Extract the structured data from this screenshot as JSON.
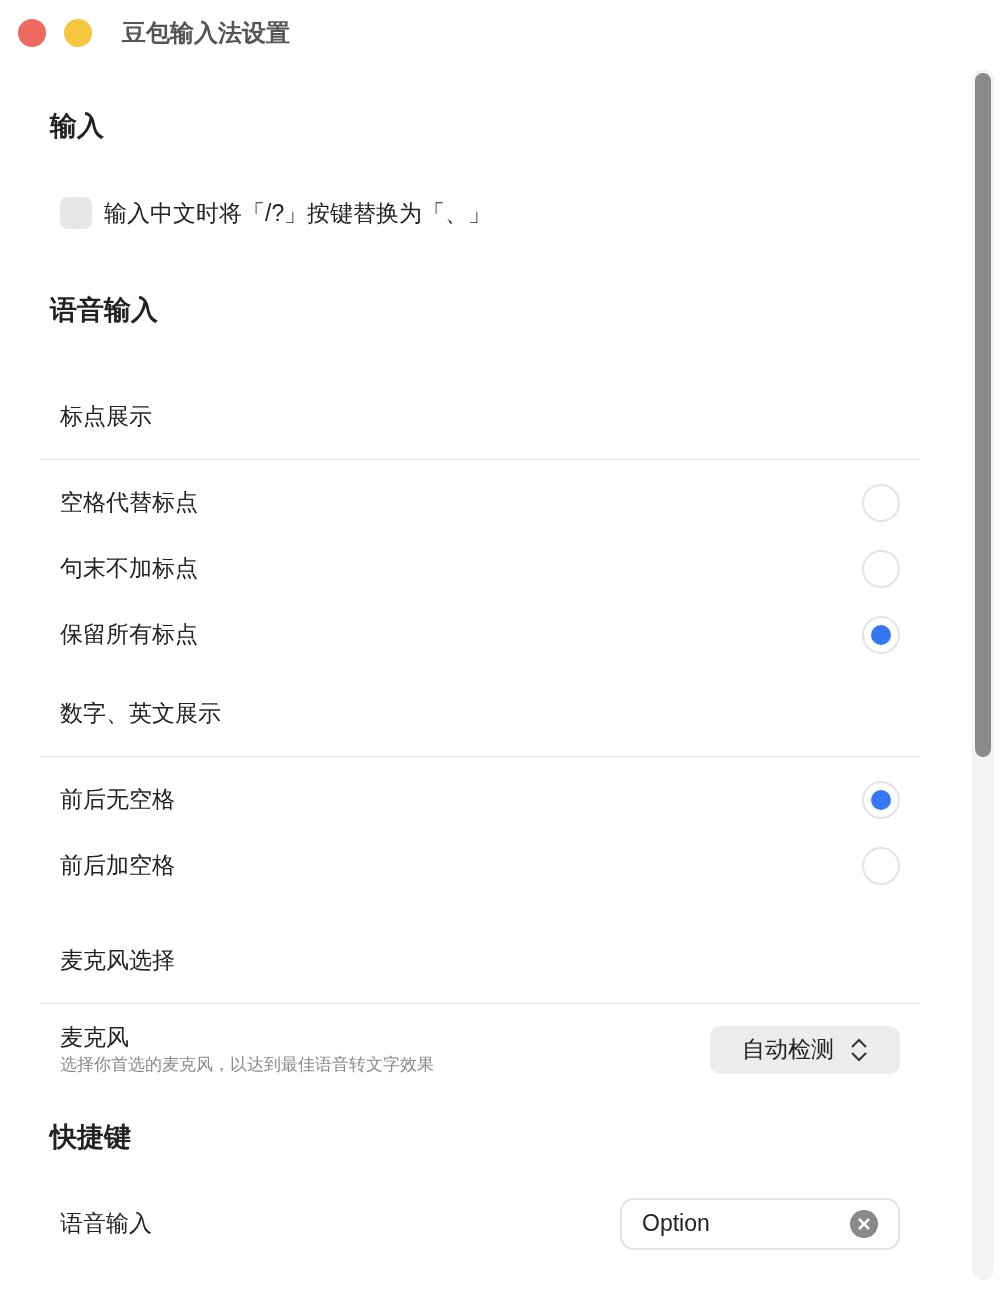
{
  "window": {
    "title": "豆包输入法设置",
    "buttons": [
      {
        "color": "#ec6a5e"
      },
      {
        "color": "#f4c73f"
      }
    ]
  },
  "sections": [
    {
      "title": "输入",
      "groups": [
        {
          "kind": "checkbox",
          "label": "输入中文时将「/?」按键替换为「、」",
          "checked": false
        }
      ]
    },
    {
      "title": "语音输入",
      "groups": [
        {
          "kind": "radio_group",
          "title": "标点展示",
          "options": [
            {
              "label": "空格代替标点",
              "selected": false
            },
            {
              "label": "句末不加标点",
              "selected": false
            },
            {
              "label": "保留所有标点",
              "selected": true
            }
          ]
        },
        {
          "kind": "radio_group",
          "title": "数字、英文展示",
          "options": [
            {
              "label": "前后无空格",
              "selected": true
            },
            {
              "label": "前后加空格",
              "selected": false
            }
          ]
        },
        {
          "kind": "select",
          "title": "麦克风选择",
          "label": "麦克风",
          "description": "选择你首选的麦克风，以达到最佳语音转文字效果",
          "value": "自动检测"
        }
      ]
    },
    {
      "title": "快捷键",
      "groups": [
        {
          "kind": "shortcut",
          "label": "语音输入",
          "value": "Option"
        }
      ]
    }
  ]
}
